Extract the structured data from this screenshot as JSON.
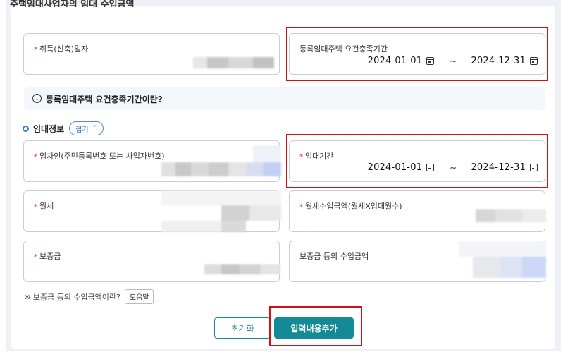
{
  "header": {
    "cutoff_title": "주택임대사업자의 임대 수입금액"
  },
  "acquisition": {
    "label": "취득(신축)일자"
  },
  "requirement_period": {
    "label": "등록임대주택 요건충족기간",
    "start": "2024-01-01",
    "end": "2024-12-31",
    "separator": "~"
  },
  "faq": {
    "text": "등록임대주택 요건충족기간이란?",
    "icon": "chevron-down-circle-icon"
  },
  "rental_info": {
    "title": "임대정보",
    "toggle_label": "접기"
  },
  "lessee": {
    "label": "임차인(주민등록번호 또는 사업자번호)"
  },
  "lease_period": {
    "label": "임대기간",
    "start": "2024-01-01",
    "end": "2024-12-31",
    "separator": "~"
  },
  "monthly_rent": {
    "label": "월세"
  },
  "monthly_income": {
    "label": "월세수입금액(월세X임대월수)"
  },
  "deposit": {
    "label": "보증금"
  },
  "deposit_income": {
    "label": "보증금 등의 수입금액"
  },
  "help": {
    "text": "※ 보증금 등의 수입금액이란?",
    "button_label": "도움말"
  },
  "actions": {
    "reset_label": "초기화",
    "add_label": "입력내용추가"
  },
  "colors": {
    "accent": "#138a96",
    "highlight": "#d0111b",
    "required": "#e0363f",
    "link": "#2e63b8"
  }
}
